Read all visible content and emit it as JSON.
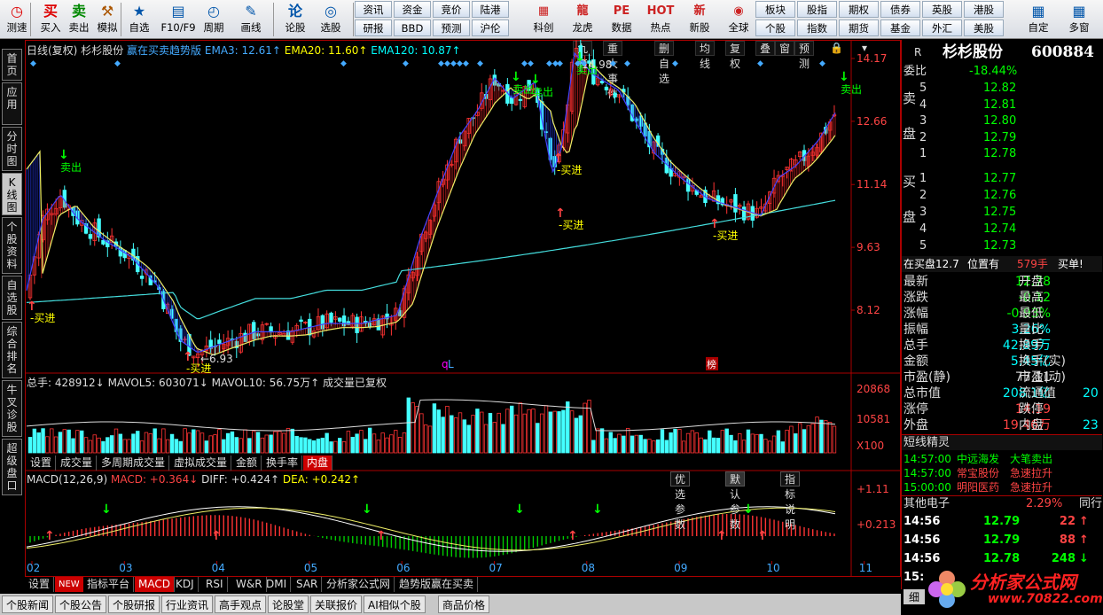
{
  "toolbar": {
    "tools": [
      {
        "label": "测速",
        "icon": "◷",
        "color": "#d00"
      },
      {
        "label": "买入",
        "icon": "买",
        "color": "#d00"
      },
      {
        "label": "卖出",
        "icon": "卖",
        "color": "#080"
      },
      {
        "label": "模拟",
        "icon": "⚒",
        "color": "#a50"
      },
      {
        "label": "自选",
        "icon": "★",
        "color": "#05a"
      },
      {
        "label": "F10/F9",
        "icon": "▤",
        "color": "#05a"
      },
      {
        "label": "周期",
        "icon": "◴",
        "color": "#05a"
      },
      {
        "label": "画线",
        "icon": "✎",
        "color": "#05a"
      },
      {
        "label": "论股",
        "icon": "论",
        "color": "#05a"
      },
      {
        "label": "选股",
        "icon": "◎",
        "color": "#05a"
      }
    ],
    "small_row1": [
      "资讯",
      "资金",
      "竞价",
      "陆港"
    ],
    "small_row2": [
      "研报",
      "BBD",
      "预测",
      "沪伦"
    ],
    "tools2": [
      {
        "label": "科创",
        "icon": "▦"
      },
      {
        "label": "龙虎",
        "icon": "龍"
      },
      {
        "label": "数据",
        "icon": "PE"
      },
      {
        "label": "热点",
        "icon": "HOT"
      },
      {
        "label": "新股",
        "icon": "新"
      },
      {
        "label": "全球",
        "icon": "◉"
      }
    ],
    "small_row3": [
      "板块",
      "股指",
      "期权",
      "债券",
      "英股",
      "港股"
    ],
    "small_row4": [
      "个股",
      "指数",
      "期货",
      "基金",
      "外汇",
      "美股"
    ],
    "tools3": [
      {
        "label": "自定",
        "icon": "▦"
      },
      {
        "label": "多窗",
        "icon": "▦"
      }
    ]
  },
  "lefttabs": [
    "首页",
    "应用",
    "分时图",
    "K线图",
    "个股资料",
    "自选股",
    "综合排名",
    "牛叉诊股",
    "超级盘口"
  ],
  "chart": {
    "header": {
      "period": "日线(复权)",
      "stock": "杉杉股份",
      "formula": "赢在买卖趋势版",
      "ema3": "EMA3: 12.61↑",
      "ema20": "EMA20: 11.60↑",
      "ema120": "EMA120: 10.87↑"
    },
    "top_tabs": [
      "九转",
      "重大事件",
      "删自选",
      "均线",
      "复权",
      "叠",
      "窗",
      "预测"
    ],
    "yaxis": [
      "14.17",
      "12.66",
      "11.14",
      "9.63",
      "8.12"
    ],
    "high_label": "14.98",
    "low_label": "6.93",
    "signals": [
      {
        "text": "买进",
        "type": "buy"
      },
      {
        "text": "卖出",
        "type": "sell"
      },
      {
        "text": "买进",
        "type": "buy"
      },
      {
        "text": "卖出",
        "type": "sell"
      },
      {
        "text": "卖出",
        "type": "sell"
      },
      {
        "text": "买进",
        "type": "buy"
      },
      {
        "text": "买进",
        "type": "buy"
      },
      {
        "text": "卖出",
        "type": "sell"
      },
      {
        "text": "买进",
        "type": "buy"
      },
      {
        "text": "卖出",
        "type": "sell"
      }
    ],
    "markers": {
      "q": "q",
      "L": "L",
      "bang": "榜"
    },
    "vol_header": {
      "total": "总手: 428912↓",
      "mavol5": "MAVOL5: 603071↓",
      "mavol10": "MAVOL10: 56.75万↑",
      "note": "成交量已复权"
    },
    "vol_yaxis": [
      "20868",
      "10581",
      "X100"
    ],
    "vol_tabs": [
      "设置",
      "成交量",
      "多周期成交量",
      "虚拟成交量",
      "金额",
      "换手率",
      "内盘"
    ],
    "macd_header": {
      "name": "MACD(12,26,9)",
      "macd": "MACD: +0.364↓",
      "diff": "DIFF: +0.424↑",
      "dea": "DEA: +0.242↑"
    },
    "macd_tabs": [
      "优选参数",
      "默认参数",
      "指标说明"
    ],
    "macd_yaxis": [
      "+1.11",
      "+0.213"
    ],
    "months": [
      "02",
      "03",
      "04",
      "05",
      "06",
      "07",
      "08",
      "09",
      "10",
      "11"
    ]
  },
  "bottom_tabs": [
    "设置",
    "指标平台",
    "MACD",
    "KDJ",
    "RSI",
    "W&R",
    "DMI",
    "SAR",
    "分析家公式网",
    "趋势版赢在买卖"
  ],
  "new_badge": "NEW",
  "news_tabs": [
    "个股新闻",
    "个股公告",
    "个股研报",
    "行业资讯",
    "高手观点",
    "论股堂",
    "关联报价",
    "AI相似个股",
    "商品价格"
  ],
  "quote": {
    "market": "R",
    "name": "杉杉股份",
    "code": "600884",
    "weibi_label": "委比",
    "weibi": "-18.44%",
    "sell_label": "卖盘",
    "buy_label": "买盘",
    "asks": [
      {
        "lvl": "5",
        "p": "12.82"
      },
      {
        "lvl": "4",
        "p": "12.81"
      },
      {
        "lvl": "3",
        "p": "12.80"
      },
      {
        "lvl": "2",
        "p": "12.79"
      },
      {
        "lvl": "1",
        "p": "12.78"
      }
    ],
    "bids": [
      {
        "lvl": "1",
        "p": "12.77"
      },
      {
        "lvl": "2",
        "p": "12.76"
      },
      {
        "lvl": "3",
        "p": "12.75"
      },
      {
        "lvl": "4",
        "p": "12.74"
      },
      {
        "lvl": "5",
        "p": "12.73"
      }
    ],
    "zai_mai": "在买盘12.7",
    "wei_zhi": "位置有",
    "wei_num": "579手",
    "buy_single": "买单!",
    "stats": [
      {
        "l": "最新",
        "v": "12.78",
        "c": "#0f0",
        "r": "开盘"
      },
      {
        "l": "涨跌",
        "v": "-0.12",
        "c": "#0f0",
        "r": "最高"
      },
      {
        "l": "涨幅",
        "v": "-0.93%",
        "c": "#0f0",
        "r": "最低"
      },
      {
        "l": "振幅",
        "v": "3.26%",
        "c": "#0ff",
        "r": "量比"
      },
      {
        "l": "总手",
        "v": "42.89万",
        "c": "#0ff",
        "r": "换手"
      },
      {
        "l": "金额",
        "v": "5.45亿",
        "c": "#0ff",
        "r": "换手(实)"
      },
      {
        "l": "市盈(静)",
        "v": "77.11",
        "c": "#ddd",
        "r": "市盈(动)"
      },
      {
        "l": "总市值",
        "v": "208.1亿",
        "c": "#0ff",
        "r": "流通值",
        "rv": "20"
      },
      {
        "l": "涨停",
        "v": "14.19",
        "c": "#f44",
        "r": "跌停"
      },
      {
        "l": "外盘",
        "v": "19.46万",
        "c": "#f44",
        "r": "内盘",
        "rv": "23"
      }
    ],
    "jl_title": "短线精灵",
    "jl": [
      {
        "t": "14:57:00",
        "n": "中远海发",
        "e": "大笔卖出",
        "ec": "#0f0",
        "nc": "#0f0"
      },
      {
        "t": "14:57:00",
        "n": "常宝股份",
        "e": "急速拉升",
        "ec": "#f44",
        "nc": "#f44"
      },
      {
        "t": "15:00:00",
        "n": "明阳医药",
        "e": "急速拉升",
        "ec": "#f44",
        "nc": "#f44"
      }
    ],
    "other": {
      "label": "其他电子",
      "val": "2.29%",
      "right": "同行"
    },
    "ticks": [
      {
        "t": "14:56",
        "p": "12.79",
        "v": "22",
        "a": "↑",
        "vc": "#f44"
      },
      {
        "t": "14:56",
        "p": "12.79",
        "v": "88",
        "a": "↑",
        "vc": "#f44"
      },
      {
        "t": "14:56",
        "p": "12.78",
        "v": "248",
        "a": "↓",
        "vc": "#0f0"
      },
      {
        "t": "15:",
        "p": "",
        "v": "",
        "a": "",
        "vc": "#ddd"
      }
    ],
    "bottom_tab": "细"
  },
  "watermark": {
    "title": "分析家公式网",
    "url": "www.70822.com"
  }
}
